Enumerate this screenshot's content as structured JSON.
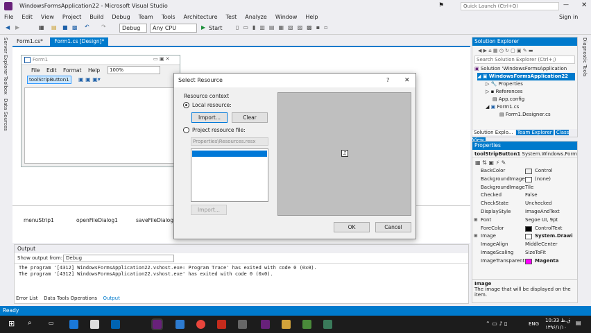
{
  "window": {
    "title": "WindowsFormsApplication22 - Microsoft Visual Studio",
    "quick_launch": "Quick Launch (Ctrl+Q)",
    "sign_in": "Sign in"
  },
  "menu": [
    "File",
    "Edit",
    "View",
    "Project",
    "Build",
    "Debug",
    "Team",
    "Tools",
    "Architecture",
    "Test",
    "Analyze",
    "Window",
    "Help"
  ],
  "toolbar": {
    "config": "Debug",
    "platform": "Any CPU",
    "start": "Start"
  },
  "left_tabs": [
    "Server Explorer",
    "Toolbox",
    "Data Sources"
  ],
  "right_tabs": [
    "Diagnostic Tools"
  ],
  "doc_tabs": [
    "Form1.cs*",
    "Form1.cs [Design]*"
  ],
  "form": {
    "title": "Form1",
    "menu": [
      "File",
      "Edit",
      "Format",
      "Help"
    ],
    "zoom": "100%",
    "toolstrip_button": "toolStripButton1"
  },
  "tray": [
    "menuStrip1",
    "openFileDialog1",
    "saveFileDialog"
  ],
  "output": {
    "title": "Output",
    "show_from_label": "Show output from:",
    "show_from_value": "Debug",
    "lines": [
      "The program '[4312] WindowsFormsApplication22.vshost.exe: Program Trace' has exited with code 0 (0x0).",
      "The program '[4312] WindowsFormsApplication22.vshost.exe' has exited with code 0 (0x0)."
    ]
  },
  "bottom_tabs": [
    "Error List",
    "Data Tools Operations",
    "Output"
  ],
  "status": "Ready",
  "solution_explorer": {
    "title": "Solution Explorer",
    "search": "Search Solution Explorer (Ctrl+;)",
    "items": [
      "Solution 'WindowsFormsApplication",
      "WindowsFormsApplication22",
      "Properties",
      "References",
      "App.config",
      "Form1.cs",
      "Form1.Designer.cs"
    ],
    "tabs": [
      "Solution Explo...",
      "Team Explorer",
      "Class View"
    ]
  },
  "properties": {
    "title": "Properties",
    "object": "toolStripButton1",
    "type": "System.Windows.Form",
    "rows": [
      [
        "BackColor",
        "Control"
      ],
      [
        "BackgroundImage",
        "(none)"
      ],
      [
        "BackgroundImage",
        "Tile"
      ],
      [
        "Checked",
        "False"
      ],
      [
        "CheckState",
        "Unchecked"
      ],
      [
        "DisplayStyle",
        "ImageAndText"
      ],
      [
        "Font",
        "Segoe UI, 9pt"
      ],
      [
        "ForeColor",
        "ControlText"
      ],
      [
        "Image",
        "System.Drawi"
      ],
      [
        "ImageAlign",
        "MiddleCenter"
      ],
      [
        "ImageScaling",
        "SizeToFit"
      ],
      [
        "ImageTransparent",
        "Magenta"
      ]
    ],
    "desc_title": "Image",
    "desc_text": "The image that will be displayed on the item."
  },
  "dialog": {
    "title": "Select Resource",
    "help": "?",
    "context": "Resource context",
    "local": "Local resource:",
    "import": "Import...",
    "clear": "Clear",
    "project": "Project resource file:",
    "resx": "Properties\\Resources.resx",
    "import2": "Import...",
    "ok": "OK",
    "cancel": "Cancel"
  },
  "clock": {
    "time": "10:33 ق.ظ",
    "date": "۱۳۹۶/۱/۱۰",
    "lang": "ENG"
  },
  "colors": {
    "accent": "#007acc",
    "magenta": "#ff00ff"
  }
}
